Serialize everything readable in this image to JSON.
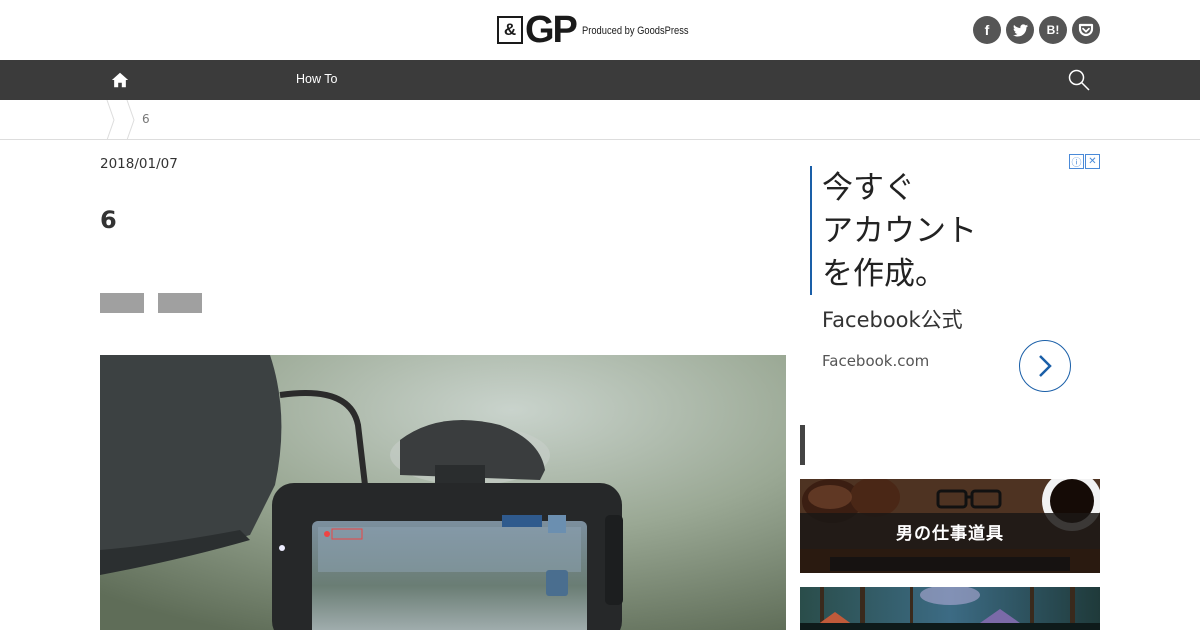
{
  "header": {
    "logo_amp": "&",
    "logo_gp": "GP",
    "logo_sub": "Produced by GoodsPress",
    "social": [
      {
        "icon": "facebook-icon",
        "glyph": "f"
      },
      {
        "icon": "twitter-icon",
        "glyph": "t"
      },
      {
        "icon": "hatena-bookmark-icon",
        "glyph": "B!"
      },
      {
        "icon": "pocket-icon",
        "glyph": "✓"
      }
    ]
  },
  "nav": {
    "home_icon": "home-icon",
    "items": [
      {
        "label": "How To"
      }
    ],
    "search_icon": "search-icon"
  },
  "breadcrumb": {
    "current": "6"
  },
  "article": {
    "date": "2018/01/07",
    "title": "6",
    "photo_desc_icon": "dashcam-photo"
  },
  "sidebar": {
    "ad": {
      "line1": "今すぐ",
      "line2": "アカウント",
      "line3": "を作成。",
      "brand": "Facebook公式",
      "url": "Facebook.com",
      "info_glyph": "ⓘ",
      "close_glyph": "✕"
    },
    "banner1_text": "男の仕事道具"
  },
  "colors": {
    "nav_bg": "#3b3b3b",
    "ad_accent": "#1a5fa8",
    "social_bg": "#555555",
    "tag_bg": "#a0a0a0"
  }
}
